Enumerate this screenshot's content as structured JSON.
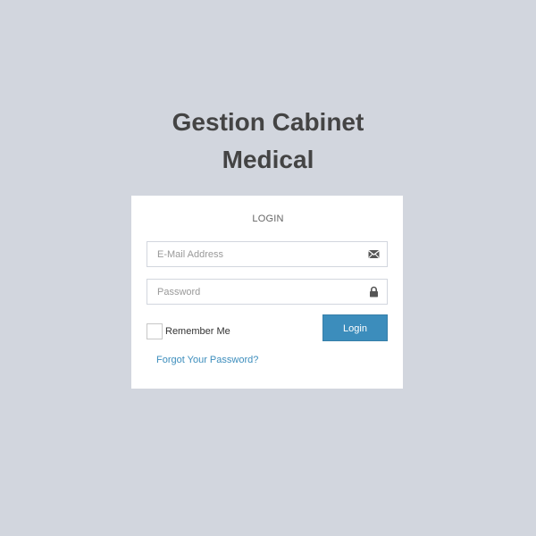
{
  "logo": {
    "line1": "Gestion Cabinet",
    "line2": "Medical"
  },
  "login_box": {
    "title": "LOGIN",
    "email": {
      "placeholder": "E-Mail Address",
      "value": "",
      "icon": "envelope-icon"
    },
    "password": {
      "placeholder": "Password",
      "value": "",
      "icon": "lock-icon"
    },
    "remember_label": "Remember Me",
    "remember_checked": false,
    "login_label": "Login",
    "forgot_label": "Forgot Your Password?"
  },
  "colors": {
    "background": "#d2d6de",
    "box": "#ffffff",
    "primary": "#3c8dbc",
    "title_text": "#444444"
  }
}
